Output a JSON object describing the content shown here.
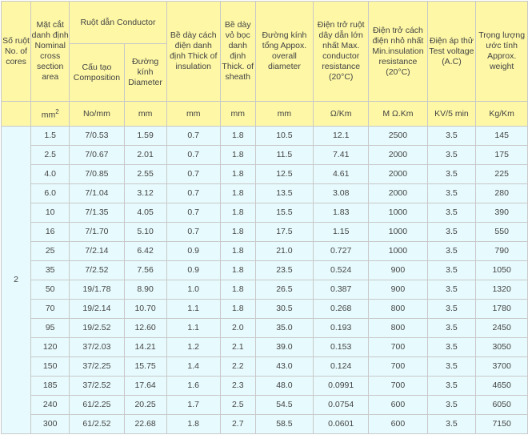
{
  "headers": {
    "cores": "Số ruột No. of cores",
    "cross_section": "Mặt cắt danh định Nominal cross section area",
    "conductor": "Ruột dẫn Conductor",
    "composition": "Cấu tạo Composition",
    "diameter": "Đường kính Diameter",
    "insulation": "Bề dày cách điện danh định Thick of insulation",
    "sheath": "Bề dày vỏ bọc danh định Thick. of sheath",
    "overall": "Đường kính tổng Appox. overall diameter",
    "resistance": "Điện trở ruột dây dẫn lớn nhất Max. conductor resistance (20°C)",
    "insulation_res": "Điện trở cách điện nhỏ nhất Min.insulation resistance (20°C)",
    "test_voltage": "Điện áp thử Test voltage (A.C)",
    "weight": "Trọng lượng ước tính Approx. weight"
  },
  "units": {
    "cross_section": "mm2",
    "composition": "No/mm",
    "diameter": "mm",
    "insulation": "mm",
    "sheath": "mm",
    "overall": "mm",
    "resistance": "Ω/Km",
    "insulation_res": "M Ω.Km",
    "test_voltage": "KV/5 min",
    "weight": "Kg/Km"
  },
  "cores_value": "2",
  "rows": [
    [
      "1.5",
      "7/0.53",
      "1.59",
      "0.7",
      "1.8",
      "10.5",
      "12.1",
      "2500",
      "3.5",
      "145"
    ],
    [
      "2.5",
      "7/0.67",
      "2.01",
      "0.7",
      "1.8",
      "11.5",
      "7.41",
      "2000",
      "3.5",
      "175"
    ],
    [
      "4.0",
      "7/0.85",
      "2.55",
      "0.7",
      "1.8",
      "12.5",
      "4.61",
      "2000",
      "3.5",
      "225"
    ],
    [
      "6.0",
      "7/1.04",
      "3.12",
      "0.7",
      "1.8",
      "13.5",
      "3.08",
      "2000",
      "3.5",
      "280"
    ],
    [
      "10",
      "7/1.35",
      "4.05",
      "0.7",
      "1.8",
      "15.5",
      "1.83",
      "1000",
      "3.5",
      "390"
    ],
    [
      "16",
      "7/1.70",
      "5.10",
      "0.7",
      "1.8",
      "17.5",
      "1.15",
      "1000",
      "3.5",
      "550"
    ],
    [
      "25",
      "7/2.14",
      "6.42",
      "0.9",
      "1.8",
      "21.0",
      "0.727",
      "1000",
      "3.5",
      "790"
    ],
    [
      "35",
      "7/2.52",
      "7.56",
      "0.9",
      "1.8",
      "23.5",
      "0.524",
      "900",
      "3.5",
      "1050"
    ],
    [
      "50",
      "19/1.78",
      "8.90",
      "1.0",
      "1.8",
      "26.5",
      "0.387",
      "900",
      "3.5",
      "1320"
    ],
    [
      "70",
      "19/2.14",
      "10.70",
      "1.1",
      "1.8",
      "30.5",
      "0.268",
      "800",
      "3.5",
      "1780"
    ],
    [
      "95",
      "19/2.52",
      "12.60",
      "1.1",
      "2.0",
      "35.0",
      "0.193",
      "800",
      "3.5",
      "2450"
    ],
    [
      "120",
      "37/2.03",
      "14.21",
      "1.2",
      "2.1",
      "39.0",
      "0.153",
      "700",
      "3.5",
      "3050"
    ],
    [
      "150",
      "37/2.25",
      "15.75",
      "1.4",
      "2.2",
      "43.0",
      "0.124",
      "700",
      "3.5",
      "3700"
    ],
    [
      "185",
      "37/2.52",
      "17.64",
      "1.6",
      "2.3",
      "48.0",
      "0.0991",
      "700",
      "3.5",
      "4650"
    ],
    [
      "240",
      "61/2.25",
      "20.25",
      "1.7",
      "2.5",
      "54.5",
      "0.0754",
      "600",
      "3.5",
      "6050"
    ],
    [
      "300",
      "61/2.52",
      "22.68",
      "1.8",
      "2.7",
      "58.5",
      "0.0601",
      "600",
      "3.5",
      "7150"
    ]
  ],
  "group_starts": [
    6,
    12
  ]
}
